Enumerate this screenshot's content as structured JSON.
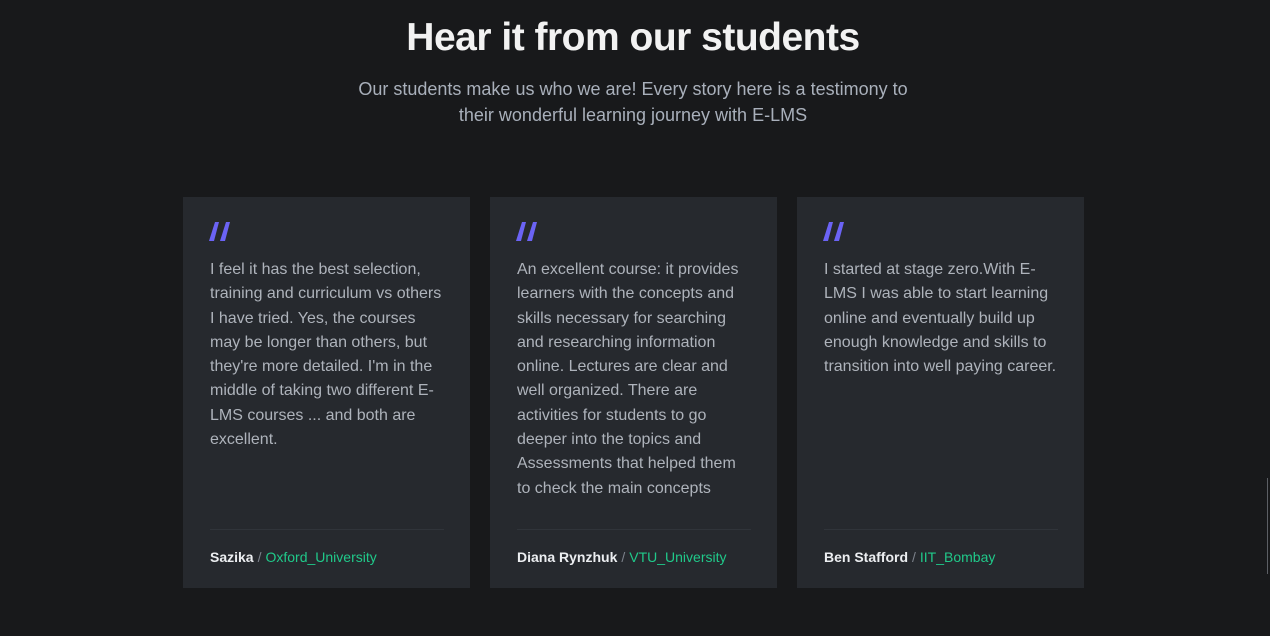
{
  "section": {
    "title": "Hear it from our students",
    "subtitle": "Our students make us who we are! Every story here is a testimony to their wonderful learning journey with E-LMS"
  },
  "colors": {
    "background": "#18191b",
    "card": "#26292e",
    "quote_icon": "#6b63f5",
    "university": "#20c98a"
  },
  "testimonials": [
    {
      "icon": "quote-icon",
      "text": "I feel it has the best selection, training and curriculum vs others I have tried. Yes, the courses may be longer than others, but they're more detailed. I'm in the middle of taking two different E-LMS courses ... and both are excellent.",
      "name": "Sazika",
      "separator": "/",
      "university": "Oxford_University"
    },
    {
      "icon": "quote-icon",
      "text": "An excellent course: it provides learners with the concepts and skills necessary for searching and researching information online. Lectures are clear and well organized. There are activities for students to go deeper into the topics and Assessments that helped them to check the main concepts",
      "name": "Diana Rynzhuk",
      "separator": "/",
      "university": "VTU_University"
    },
    {
      "icon": "quote-icon",
      "text": "I started at stage zero.With E-LMS I was able to start learning online and eventually build up enough knowledge and skills to transition into well paying career.",
      "name": "Ben Stafford",
      "separator": "/",
      "university": "IIT_Bombay"
    }
  ]
}
